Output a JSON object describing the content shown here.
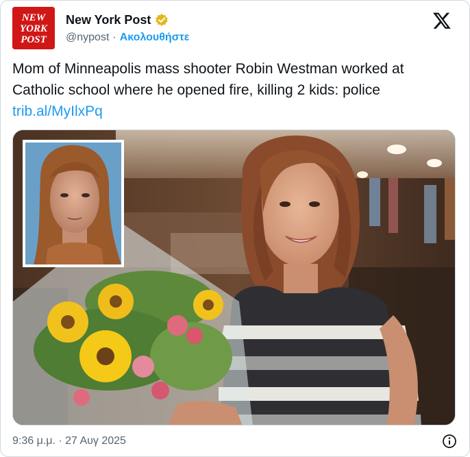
{
  "author": {
    "name": "New York Post",
    "handle": "@nypost",
    "separator": "·",
    "follow_label": "Ακολουθήστε",
    "avatar_text": [
      "NEW",
      "YORK",
      "POST"
    ]
  },
  "tweet": {
    "text": "Mom of Minneapolis mass shooter Robin Westman worked at Catholic school where he opened fire, killing 2 kids: police ",
    "link_text": "trib.al/MyIlxPq"
  },
  "footer": {
    "timestamp": "9:36 μ.μ. · 27 Αυγ 2025"
  },
  "colors": {
    "link": "#1d9bf0",
    "verified_badge": "#e2b719",
    "avatar_bg": "#d11616",
    "secondary_text": "#536471"
  },
  "icons": {
    "brand": "x-logo-icon",
    "verified": "verified-badge-icon",
    "info": "info-icon"
  }
}
